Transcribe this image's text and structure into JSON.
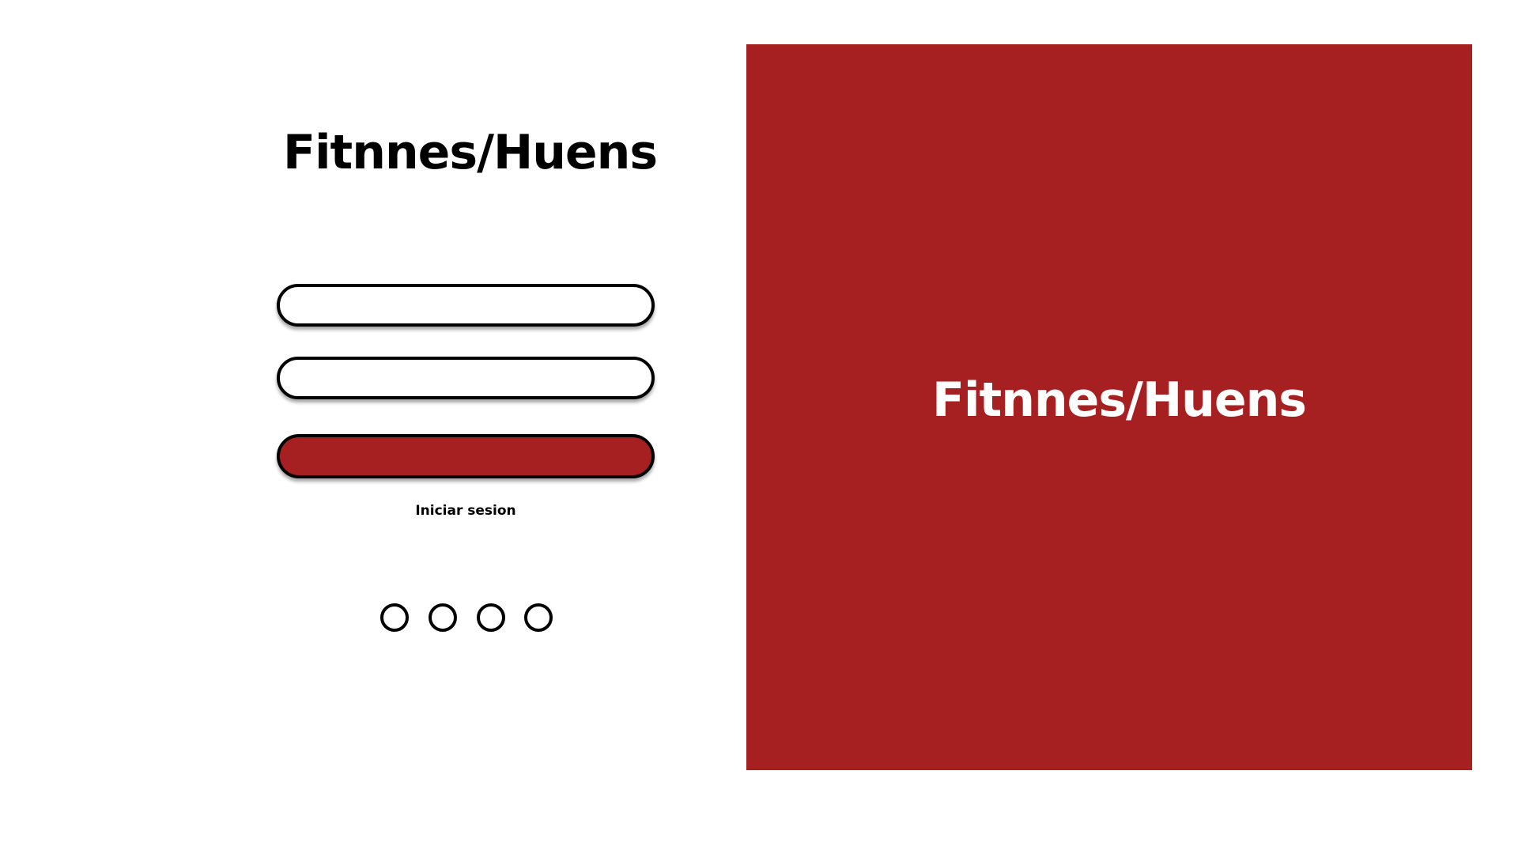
{
  "login": {
    "title": "Fitnnes/Huens",
    "username_field": {
      "value": "",
      "placeholder": ""
    },
    "password_field": {
      "value": "",
      "placeholder": ""
    },
    "submit_button_label": "",
    "submit_caption": "Iniciar sesion",
    "social_buttons": [
      {
        "icon": "circle-icon"
      },
      {
        "icon": "circle-icon"
      },
      {
        "icon": "circle-icon"
      },
      {
        "icon": "circle-icon"
      }
    ]
  },
  "brand_panel": {
    "title": "Fitnnes/Huens"
  },
  "colors": {
    "accent": "#a61f21",
    "background": "#ffffff",
    "text": "#000000",
    "panel_text": "#ffffff"
  }
}
